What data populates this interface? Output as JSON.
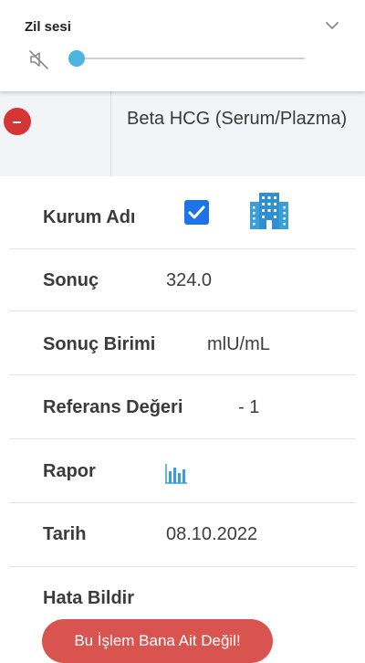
{
  "volume_panel": {
    "title": "Zil sesi",
    "icon": "volume-muted-icon",
    "level_percent": 0,
    "accent_color": "#4db6e0"
  },
  "test": {
    "name": "Beta HCG (Serum/Plazma)",
    "collapse_color": "#d63535"
  },
  "details": {
    "institution_label": "Kurum Adı",
    "institution_checked": true,
    "result_label": "Sonuç",
    "result_value": "324.0",
    "unit_label": "Sonuç Birimi",
    "unit_value": "mlU/mL",
    "reference_label": "Referans Değeri",
    "reference_value": "- 1",
    "report_label": "Rapor",
    "date_label": "Tarih",
    "date_value": "08.10.2022",
    "error_label": "Hata Bildir",
    "error_button_label": "Bu İşlem Bana Ait Değil!"
  }
}
